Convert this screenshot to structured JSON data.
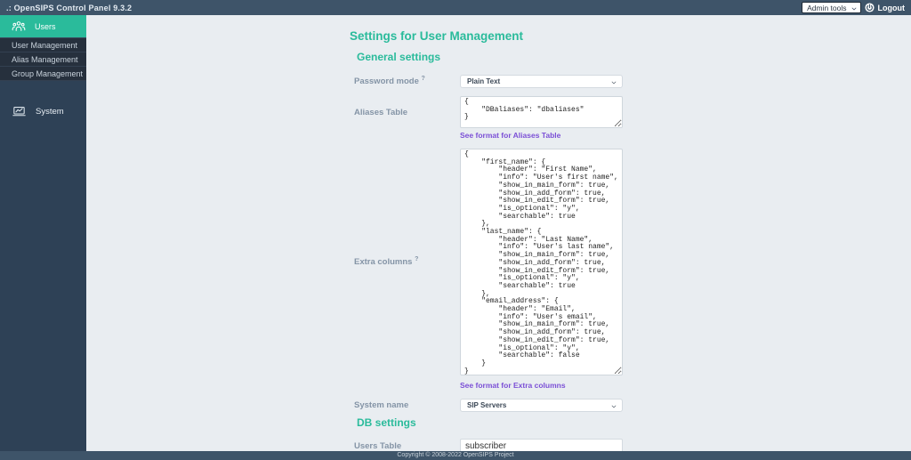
{
  "topbar": {
    "title": ".: OpenSIPS Control Panel 9.3.2",
    "admin_tools_label": "Admin tools",
    "logout_label": "Logout"
  },
  "sidebar": {
    "users": {
      "label": "Users"
    },
    "items": [
      {
        "label": "User Management"
      },
      {
        "label": "Alias Management"
      },
      {
        "label": "Group Management"
      }
    ],
    "system": {
      "label": "System"
    }
  },
  "main": {
    "page_title": "Settings for User Management",
    "sections": {
      "general": "General settings",
      "db": "DB settings"
    },
    "fields": {
      "password_mode": {
        "label": "Password mode",
        "help": "?",
        "value": "Plain Text"
      },
      "aliases_table": {
        "label": "Aliases Table",
        "value": "{\n    \"DBaliases\": \"dbaliases\"\n}",
        "link": "See format for Aliases Table"
      },
      "extra_columns": {
        "label": "Extra columns",
        "help": "?",
        "value": "{\n    \"first_name\": {\n        \"header\": \"First Name\",\n        \"info\": \"User's first name\",\n        \"show_in_main_form\": true,\n        \"show_in_add_form\": true,\n        \"show_in_edit_form\": true,\n        \"is_optional\": \"y\",\n        \"searchable\": true\n    },\n    \"last_name\": {\n        \"header\": \"Last Name\",\n        \"info\": \"User's last name\",\n        \"show_in_main_form\": true,\n        \"show_in_add_form\": true,\n        \"show_in_edit_form\": true,\n        \"is_optional\": \"y\",\n        \"searchable\": true\n    },\n    \"email_address\": {\n        \"header\": \"Email\",\n        \"info\": \"User's email\",\n        \"show_in_main_form\": true,\n        \"show_in_add_form\": true,\n        \"show_in_edit_form\": true,\n        \"is_optional\": \"y\",\n        \"searchable\": false\n    }\n}",
        "link": "See format for Extra columns"
      },
      "system_name": {
        "label": "System name",
        "value": "SIP Servers"
      },
      "users_table": {
        "label": "Users Table",
        "value": "subscriber"
      }
    }
  },
  "footer": {
    "copyright": "Copyright © 2008-2022 OpenSIPS Project"
  },
  "colors": {
    "accent": "#2abb9b",
    "topbar": "#3e5469",
    "sidebar": "#2e4156",
    "sidebar_submenu": "#26303d",
    "link": "#7b4fd6",
    "content_bg": "#e9edf1"
  }
}
